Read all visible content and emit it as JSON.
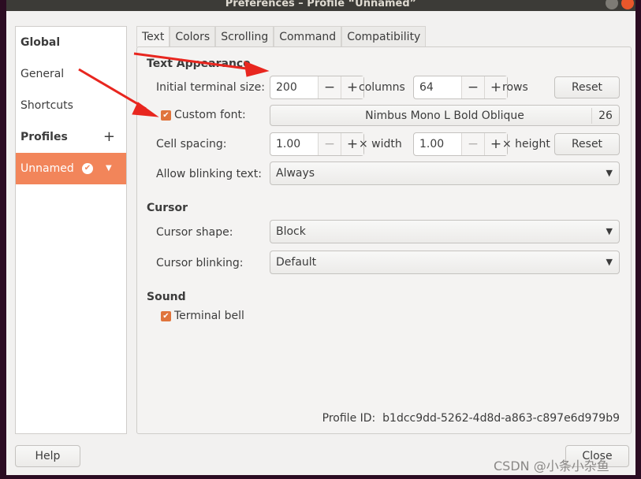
{
  "window": {
    "title": "Preferences – Profile “Unnamed”"
  },
  "sidebar": {
    "global": "Global",
    "general": "General",
    "shortcuts": "Shortcuts",
    "profiles": "Profiles",
    "add": "+",
    "profile_name": "Unnamed"
  },
  "tabs": [
    "Text",
    "Colors",
    "Scrolling",
    "Command",
    "Compatibility"
  ],
  "text_appearance": {
    "heading": "Text Appearance",
    "size_label": "Initial terminal size:",
    "columns": "200",
    "columns_unit": "columns",
    "rows": "64",
    "rows_unit": "rows",
    "reset": "Reset",
    "custom_font_label": "Custom font:",
    "custom_font_checked": true,
    "font_name": "Nimbus Mono L Bold Oblique",
    "font_size": "26",
    "cell_spacing_label": "Cell spacing:",
    "width_value": "1.00",
    "width_unit": "× width",
    "height_value": "1.00",
    "height_unit": "× height",
    "reset2": "Reset",
    "blink_label": "Allow blinking text:",
    "blink_value": "Always"
  },
  "cursor": {
    "heading": "Cursor",
    "shape_label": "Cursor shape:",
    "shape_value": "Block",
    "blink_label": "Cursor blinking:",
    "blink_value": "Default"
  },
  "sound": {
    "heading": "Sound",
    "bell_label": "Terminal bell",
    "bell_checked": true
  },
  "profile_id": {
    "label": "Profile ID:",
    "value": "b1dcc9dd-5262-4d8d-a863-c897e6d979b9"
  },
  "buttons": {
    "help": "Help",
    "close": "Close",
    "minus": "−",
    "plus": "+"
  },
  "watermark": "CSDN @小条小杂鱼",
  "colors": {
    "accent": "#f2855a",
    "arrow": "#e8261f"
  }
}
